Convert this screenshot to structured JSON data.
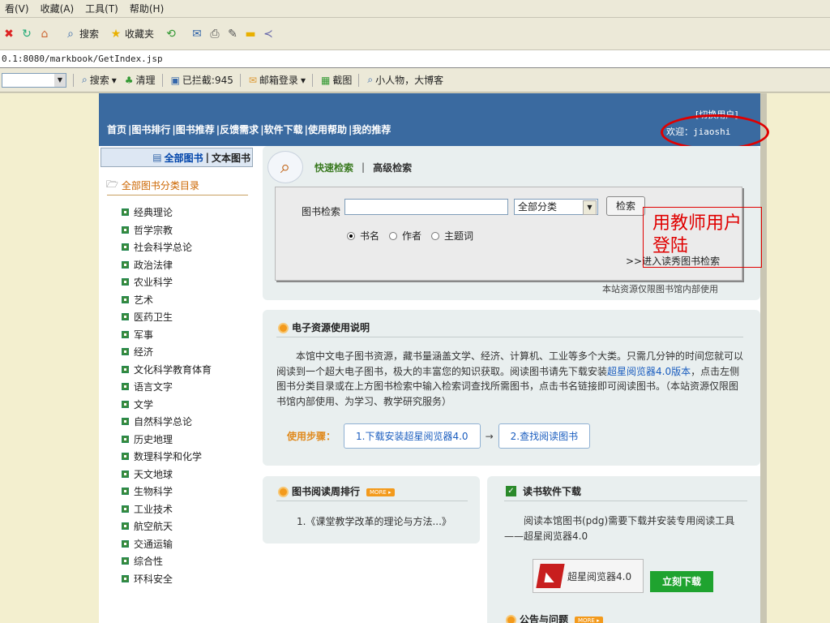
{
  "menubar": {
    "items": [
      "看(V)",
      "收藏(A)",
      "工具(T)",
      "帮助(H)"
    ]
  },
  "toolbar": {
    "search_label": "搜索",
    "favorites_label": "收藏夹"
  },
  "address": {
    "url": "0.1:8080/markbook/GetIndex.jsp"
  },
  "yahoo_bar": {
    "items": [
      "搜索",
      "清理",
      "已拦截:945",
      "邮箱登录",
      "截图",
      "小人物，大博客"
    ]
  },
  "header": {
    "nav": [
      "首页",
      "|图书排行",
      "|图书推荐",
      "|反馈需求",
      "|软件下载",
      "|使用帮助",
      "|我的推荐"
    ],
    "switch_user": "[切换用户]",
    "welcome_prefix": "欢迎：",
    "username": "jiaoshi"
  },
  "sidebar": {
    "tab_all": "全部图书",
    "tab_sep": "|",
    "tab_text": "文本图书",
    "category_title": "全部图书分类目录",
    "categories": [
      "经典理论",
      "哲学宗教",
      "社会科学总论",
      "政治法律",
      "农业科学",
      "艺术",
      "医药卫生",
      "军事",
      "经济",
      "文化科学教育体育",
      "语言文字",
      "文学",
      "自然科学总论",
      "历史地理",
      "数理科学和化学",
      "天文地球",
      "生物科学",
      "工业技术",
      "航空航天",
      "交通运输",
      "综合性",
      "环科安全"
    ]
  },
  "search": {
    "tab_quick": "快速检索",
    "tab_sep": "|",
    "tab_advanced": "高级检索",
    "label": "图书检索",
    "input_value": "",
    "category_selected": "全部分类",
    "button": "检索",
    "radio_options": [
      "书名",
      "作者",
      "主题词"
    ],
    "radio_selected": 0,
    "showcase_link": ">>进入读秀图书检索",
    "notice": "本站资源仅限图书馆内部使用"
  },
  "annotation": {
    "text": "用教师用户登陆",
    "color": "#e00000"
  },
  "eresource": {
    "title": "电子资源使用说明",
    "text_1": "本馆中文电子图书资源，藏书量涵盖文学、经济、计算机、工业等多个大类。只需几分钟的时间您就可以阅读到一个超大电子图书，极大的丰富您的知识获取。阅读图书请先下载安装",
    "text_link": "超星阅览器4.0版本",
    "text_2": "，点击左侧图书分类目录或在上方图书检索中输入检索词查找所需图书，点击书名链接即可阅读图书。（本站资源仅限图书馆内部使用、为学习、教学研究服务）",
    "steps_label": "使用步骤：",
    "step1": "1.下载安装超星阅览器4.0",
    "step_arrow": "→",
    "step2": "2.查找阅读图书"
  },
  "ranking": {
    "title": "图书阅读周排行",
    "more": "MORE ▸",
    "items": [
      "1.《课堂教学改革的理论与方法...》"
    ]
  },
  "download": {
    "title": "读书软件下载",
    "text": "阅读本馆图书(pdg)需要下载并安装专用阅读工具——超星阅览器4.0",
    "reader_name": "超星阅览器4.0",
    "button": "立刻下载"
  },
  "announce": {
    "title": "公告与问题",
    "more": "MORE ▸"
  },
  "colors": {
    "banner": "#3a6aa0",
    "accent_orange": "#f39a1c",
    "red": "#e00000",
    "green": "#1fa32f"
  }
}
